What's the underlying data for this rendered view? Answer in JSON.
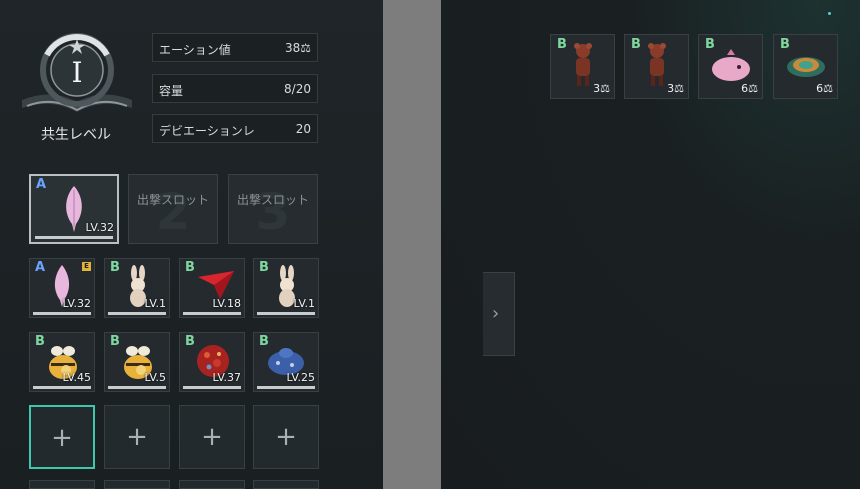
{
  "level_emblem": {
    "numeral": "I",
    "label": "共生レベル"
  },
  "stats": [
    {
      "label": "エーション値",
      "value": "38⚖"
    },
    {
      "label": "容量",
      "value": "8/20"
    },
    {
      "label": "デビエーションレ",
      "value": "20"
    }
  ],
  "slots": [
    {
      "grade": "A",
      "level": "LV.32"
    },
    {
      "text": "出撃スロット",
      "number": "2"
    },
    {
      "text": "出撃スロット",
      "number": "3"
    }
  ],
  "cards": [
    {
      "grade": "A",
      "level": "LV.32",
      "badge": "E",
      "icon": "pink-feather-icon"
    },
    {
      "grade": "B",
      "level": "LV.1",
      "icon": "bunny-plush-icon"
    },
    {
      "grade": "B",
      "level": "LV.18",
      "icon": "red-arrowhead-icon"
    },
    {
      "grade": "B",
      "level": "LV.1",
      "icon": "bunny-plush-icon"
    },
    {
      "grade": "B",
      "level": "LV.45",
      "icon": "bee-icon"
    },
    {
      "grade": "B",
      "level": "LV.5",
      "icon": "bee-icon"
    },
    {
      "grade": "B",
      "level": "LV.37",
      "icon": "red-orb-icon"
    },
    {
      "grade": "B",
      "level": "LV.25",
      "icon": "blue-blob-icon"
    }
  ],
  "add_label": "+",
  "inventory": [
    {
      "grade": "B",
      "count": "3⚖",
      "icon": "brown-figure-icon"
    },
    {
      "grade": "B",
      "count": "3⚖",
      "icon": "brown-figure-icon"
    },
    {
      "grade": "B",
      "count": "6⚖",
      "icon": "pink-bird-icon"
    },
    {
      "grade": "B",
      "count": "6⚖",
      "icon": "turtle-shell-icon"
    }
  ]
}
